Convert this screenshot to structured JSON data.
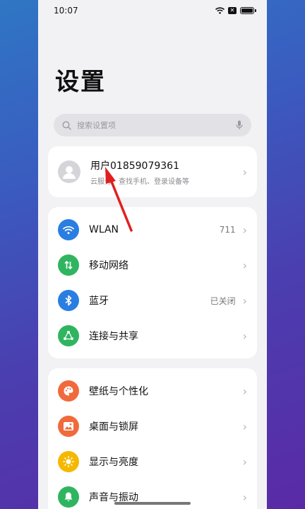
{
  "status_bar": {
    "time": "10:07",
    "notification_badge": "✕"
  },
  "page_title": "设置",
  "search": {
    "placeholder": "搜索设置项"
  },
  "account": {
    "name": "用户01859079361",
    "subtitle": "云服务、查找手机、登录设备等"
  },
  "group1": [
    {
      "label": "WLAN",
      "value": "711",
      "icon": "wifi-icon",
      "color": "#2a7de1"
    },
    {
      "label": "移动网络",
      "value": "",
      "icon": "mobile-data-icon",
      "color": "#2fb560"
    },
    {
      "label": "蓝牙",
      "value": "已关闭",
      "icon": "bluetooth-icon",
      "color": "#2a7de1"
    },
    {
      "label": "连接与共享",
      "value": "",
      "icon": "share-icon",
      "color": "#2fb560"
    }
  ],
  "group2": [
    {
      "label": "壁纸与个性化",
      "icon": "palette-icon",
      "color": "#f06a3c"
    },
    {
      "label": "桌面与锁屏",
      "icon": "wallpaper-icon",
      "color": "#f06a3c"
    },
    {
      "label": "显示与亮度",
      "icon": "sun-icon",
      "color": "#f5b800"
    },
    {
      "label": "声音与振动",
      "icon": "bell-icon",
      "color": "#2fb560"
    }
  ],
  "annotation_color": "#e02020"
}
